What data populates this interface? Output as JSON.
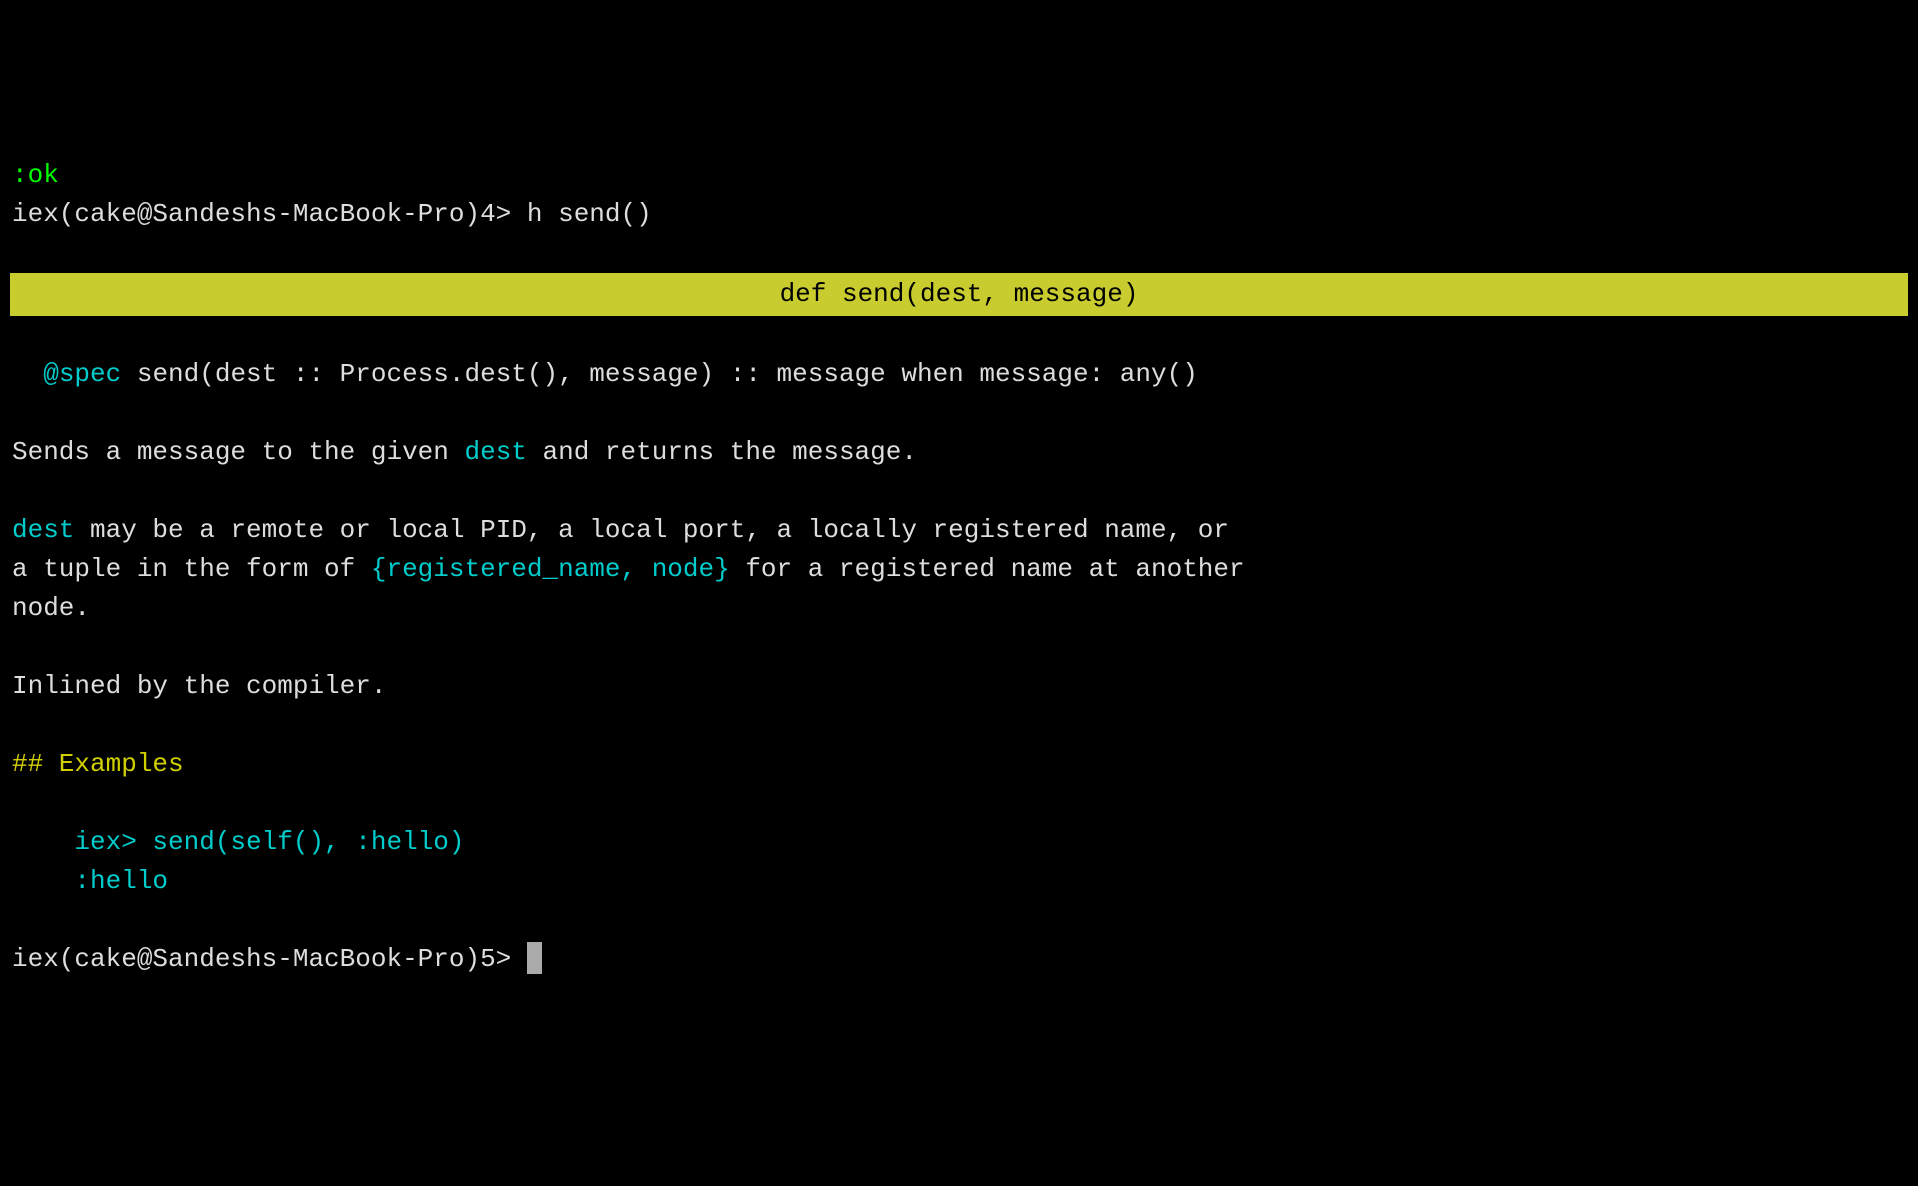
{
  "top_partial": ":ok",
  "prompt1_prefix": "iex(cake@Sandeshs-MacBook-Pro)4> ",
  "prompt1_cmd": "h send()",
  "banner": "def send(dest, message)",
  "spec_indent": "  ",
  "spec_keyword": "@spec",
  "spec_rest": " send(dest :: Process.dest(), message) :: message when message: any()",
  "desc_p1_a": "Sends a message to the given ",
  "desc_p1_dest": "dest",
  "desc_p1_b": " and returns the message.",
  "desc_p2_dest": "dest",
  "desc_p2_a": " may be a remote or local PID, a local port, a locally registered name, or",
  "desc_p2_b": "a tuple in the form of ",
  "desc_p2_code": "{registered_name, node}",
  "desc_p2_c": " for a registered name at another",
  "desc_p2_d": "node.",
  "inlined": "Inlined by the compiler.",
  "examples_heading": "## Examples",
  "example_line1": "    iex> send(self(), :hello)",
  "example_line2": "    :hello",
  "prompt2": "iex(cake@Sandeshs-MacBook-Pro)5> "
}
